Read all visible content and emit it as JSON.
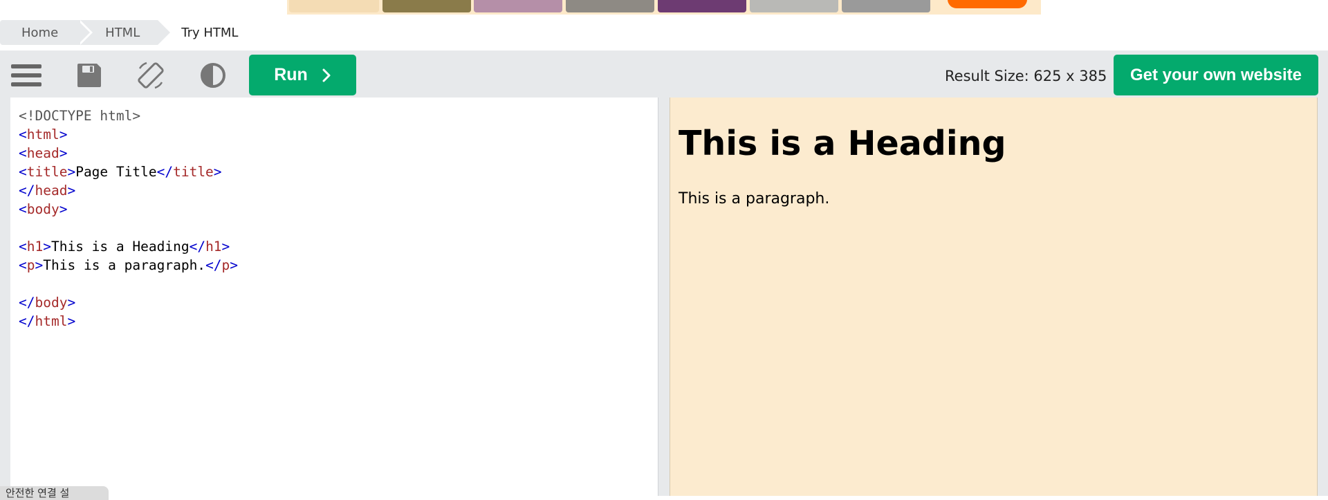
{
  "breadcrumb": [
    "Home",
    "HTML",
    "Try HTML"
  ],
  "toolbar": {
    "menu_icon": "hamburger-menu-icon",
    "save_icon": "floppy-disk-icon",
    "rotate_icon": "rotate-orientation-icon",
    "theme_icon": "contrast-theme-icon",
    "run_label": "Run",
    "run_icon": "chevron-right-icon",
    "result_size": "Result Size: 625 x 385",
    "own_website_label": "Get your own website"
  },
  "editor": {
    "lines": [
      "<!DOCTYPE html>",
      "<html>",
      "<head>",
      "<title>Page Title</title>",
      "</head>",
      "<body>",
      "",
      "<h1>This is a Heading</h1>",
      "<p>This is a paragraph.</p>",
      "",
      "</body>",
      "</html>"
    ]
  },
  "result": {
    "heading": "This is a Heading",
    "paragraph": "This is a paragraph."
  },
  "status_text": "안전한 연결 설",
  "colors": {
    "accent": "#04aa6d",
    "toolbar_bg": "#e7e9eb",
    "result_bg": "#fcebcf",
    "tag": "#a52a2a",
    "bracket": "#0000cd"
  }
}
